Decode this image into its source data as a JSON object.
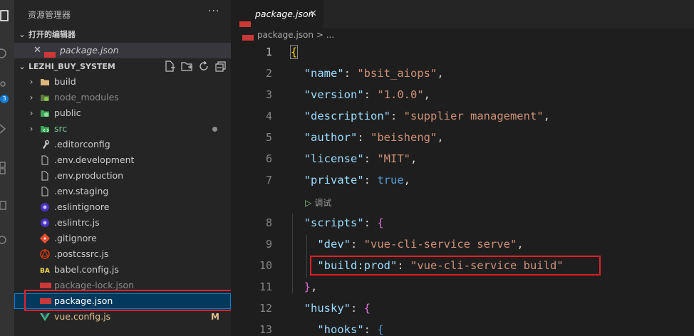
{
  "sidebar": {
    "title": "资源管理器",
    "more": "···",
    "open_editors": {
      "header": "打开的编辑器",
      "items": [
        {
          "name": "package.json",
          "close": "✕"
        }
      ]
    },
    "project": {
      "header": "LEZHI_BUY_SYSTEM",
      "tree": [
        {
          "name": "build",
          "kind": "folder"
        },
        {
          "name": "node_modules",
          "kind": "folder"
        },
        {
          "name": "public",
          "kind": "folder"
        },
        {
          "name": "src",
          "kind": "folder"
        },
        {
          "name": ".editorconfig",
          "kind": "file"
        },
        {
          "name": ".env.development",
          "kind": "file"
        },
        {
          "name": ".env.production",
          "kind": "file"
        },
        {
          "name": ".env.staging",
          "kind": "file"
        },
        {
          "name": ".eslintignore",
          "kind": "file"
        },
        {
          "name": ".eslintrc.js",
          "kind": "file"
        },
        {
          "name": ".gitignore",
          "kind": "file"
        },
        {
          "name": ".postcssrc.js",
          "kind": "file"
        },
        {
          "name": "babel.config.js",
          "kind": "file"
        },
        {
          "name": "package-lock.json",
          "kind": "file"
        },
        {
          "name": "package.json",
          "kind": "file",
          "selected": true
        },
        {
          "name": "vue.config.js",
          "kind": "file",
          "badge": "M"
        }
      ]
    }
  },
  "activity": {
    "scm_badge": "3"
  },
  "editor": {
    "tab": {
      "name": "package.json",
      "close": "✕"
    },
    "breadcrumb": "package.json > ...",
    "codelens": "调试",
    "lines": [
      {
        "n": "1",
        "text": "{"
      },
      {
        "n": "2",
        "text": "  \"name\": \"bsit_aiops\","
      },
      {
        "n": "3",
        "text": "  \"version\": \"1.0.0\","
      },
      {
        "n": "4",
        "text": "  \"description\": \"supplier management\","
      },
      {
        "n": "5",
        "text": "  \"author\": \"beisheng\","
      },
      {
        "n": "6",
        "text": "  \"license\": \"MIT\","
      },
      {
        "n": "7",
        "text": "  \"private\": true,"
      },
      {
        "n": "8",
        "text": "  \"scripts\": {"
      },
      {
        "n": "9",
        "text": "    \"dev\": \"vue-cli-service serve\","
      },
      {
        "n": "10",
        "text": "    \"build:prod\": \"vue-cli-service build\""
      },
      {
        "n": "11",
        "text": "  },"
      },
      {
        "n": "12",
        "text": "  \"husky\": {"
      },
      {
        "n": "13",
        "text": "    \"hooks\": {"
      }
    ]
  }
}
